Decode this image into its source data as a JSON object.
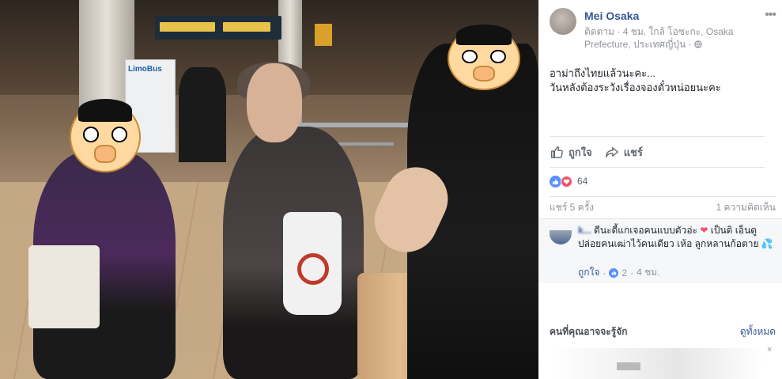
{
  "post": {
    "author": "Mei Osaka",
    "meta": "ติดตาม · 4 ชม. ใกล้ โอซะกะ, Osaka Prefecture, ประเทศญี่ปุ่น ·",
    "text_line1": "อาม่าถึงไทยแล้วนะคะ...",
    "text_line2": "วันหลังต้องระวังเรื่องจองตั๋วหน่อยนะคะ",
    "more_icon": "ellipsis-icon",
    "privacy_icon": "globe-icon"
  },
  "actions": {
    "like_label": "ถูกใจ",
    "share_label": "แชร์"
  },
  "reactions": {
    "count": "64",
    "types": [
      "like",
      "love"
    ],
    "like_color": "#5890ff",
    "love_color": "#f25268"
  },
  "stats": {
    "shares": "แชร์ 5 ครั้ง",
    "comments": "1 ความคิดเห็น"
  },
  "comment": {
    "author": "k...",
    "text_a": "ดีนะดี้แกเจอคนแบบตัวอ่ะ",
    "text_b": "เป็นดิ เอ็นดูปล่อยคนเฒ่าไว้คนเดียว เห้อ ลูกหลานก้อตาย",
    "like_label": "ถูกใจ",
    "like_count": "2",
    "time": "4 ชม."
  },
  "pymk": {
    "title": "คนที่คุณอาจจะรู้จัก",
    "see_all": "ดูทั้งหมด",
    "close": "×"
  },
  "photo": {
    "sign_text": "LimoBus"
  },
  "colors": {
    "link": "#365899",
    "muted": "#90949c",
    "text": "#1d2129"
  }
}
